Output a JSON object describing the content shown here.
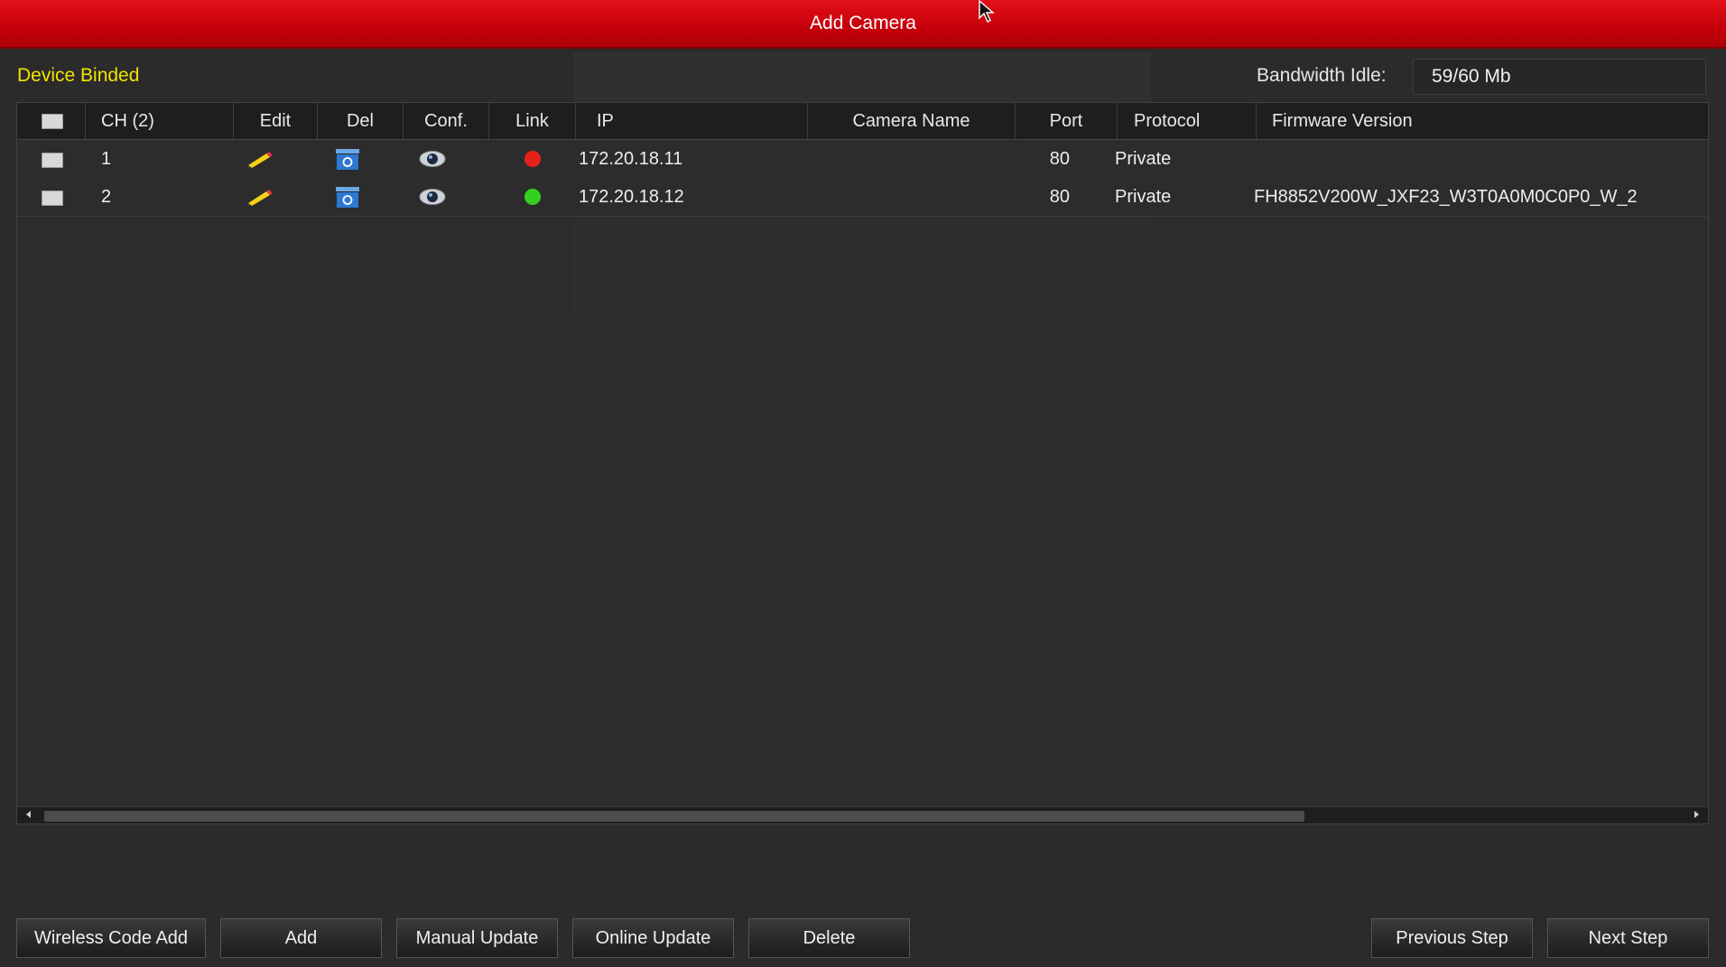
{
  "window": {
    "title": "Add Camera"
  },
  "section": {
    "label": "Device Binded"
  },
  "bandwidth": {
    "label": "Bandwidth Idle:",
    "value": "59/60 Mb"
  },
  "table": {
    "columns": [
      "CH (2)",
      "Edit",
      "Del",
      "Conf.",
      "Link",
      "IP",
      "Camera Name",
      "Port",
      "Protocol",
      "Firmware Version"
    ],
    "rows": [
      {
        "ch": "1",
        "link_status": "offline",
        "link_color": "#e8201a",
        "ip": "172.20.18.11",
        "camera_name": "",
        "port": "80",
        "protocol": "Private",
        "firmware": ""
      },
      {
        "ch": "2",
        "link_status": "online",
        "link_color": "#34d01e",
        "ip": "172.20.18.12",
        "camera_name": "",
        "port": "80",
        "protocol": "Private",
        "firmware": "FH8852V200W_JXF23_W3T0A0M0C0P0_W_2"
      }
    ],
    "icons": {
      "edit": "pencil-icon",
      "delete": "trash-icon",
      "config": "camera-icon"
    },
    "scroll_fraction": 0.77
  },
  "buttons": {
    "wireless_code_add": "Wireless Code Add",
    "add": "Add",
    "manual_update": "Manual Update",
    "online_update": "Online Update",
    "delete": "Delete",
    "previous_step": "Previous Step",
    "next_step": "Next Step"
  },
  "colors": {
    "title_bar": "#d10a12",
    "section_label": "#f0e400",
    "link_offline": "#e8201a",
    "link_online": "#34d01e"
  }
}
